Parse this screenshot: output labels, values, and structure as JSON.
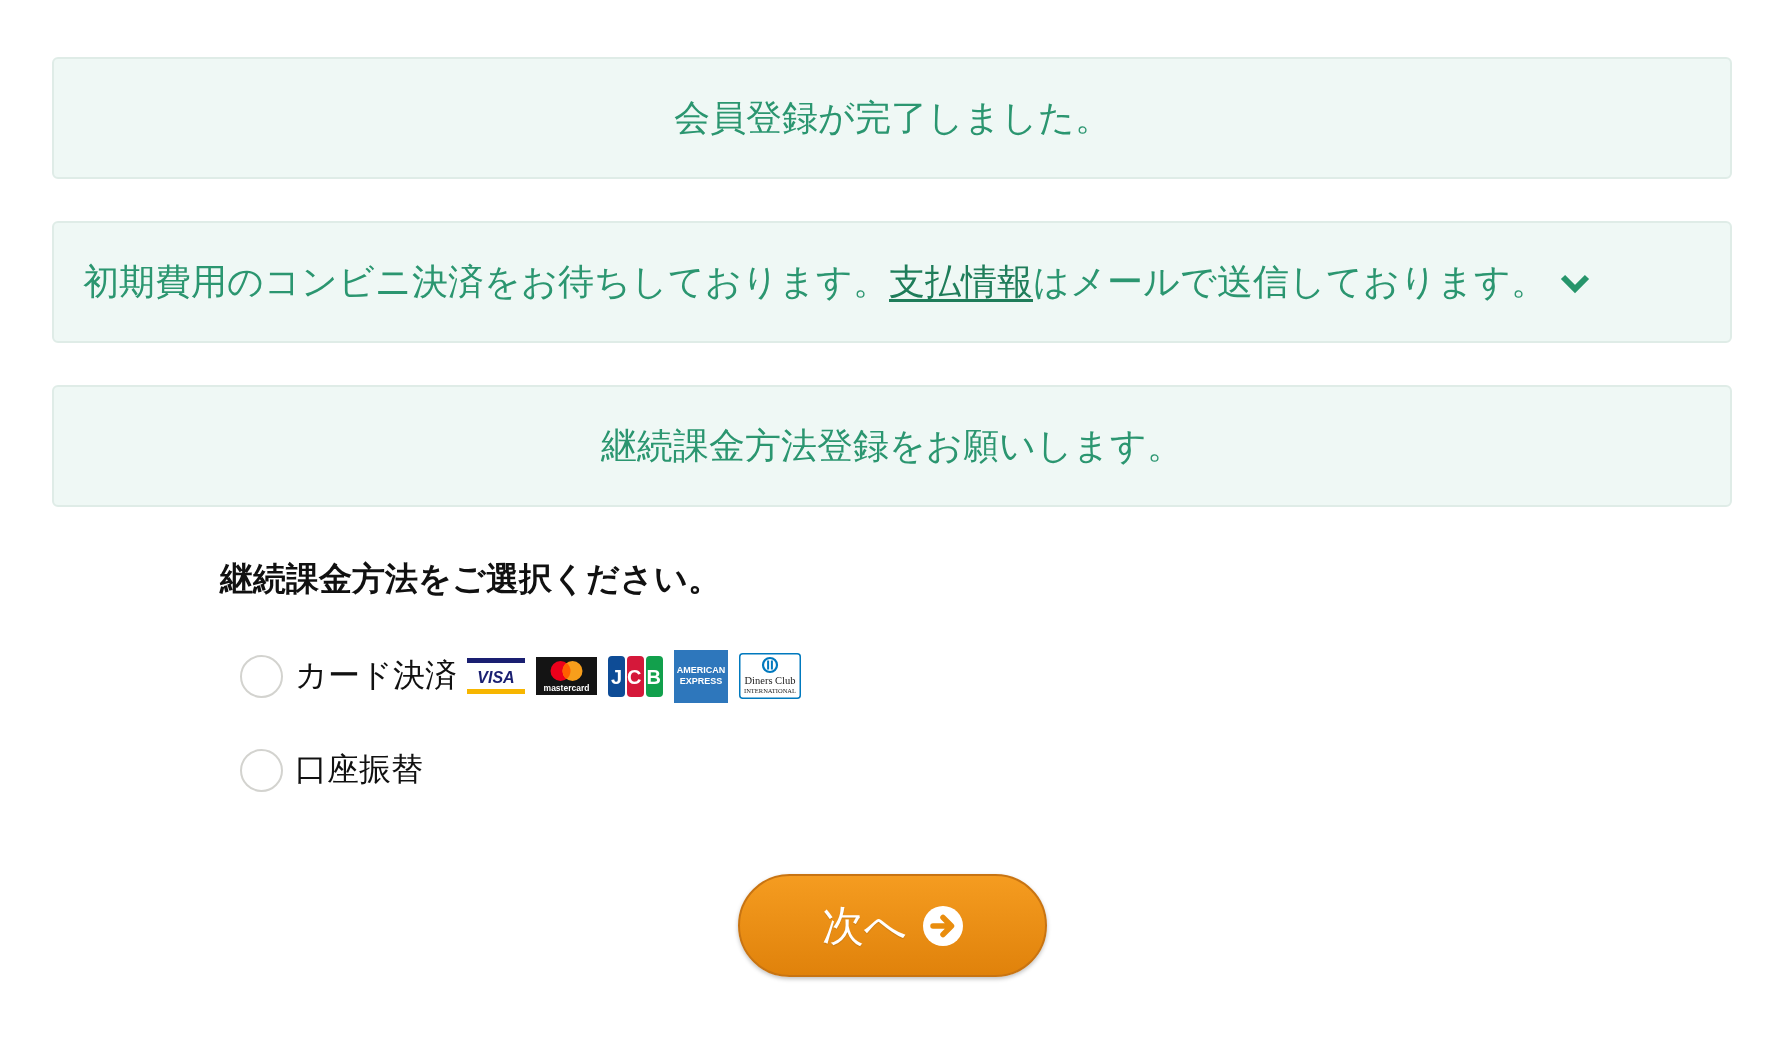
{
  "notices": [
    {
      "kind": "message",
      "text": "会員登録が完了しました。"
    },
    {
      "kind": "expandable",
      "text_before": "初期費用のコンビニ決済をお待ちしております。",
      "link": "支払情報",
      "text_after": "はメールで送信しております。",
      "expanded": false
    },
    {
      "kind": "message",
      "text": "継続課金方法登録をお願いします。"
    }
  ],
  "payment": {
    "heading": "継続課金方法をご選択ください。",
    "options": [
      {
        "label": "カード決済",
        "selected": false,
        "card_brands": [
          {
            "kind": "visa",
            "lines": [
              "VISA"
            ]
          },
          {
            "kind": "mastercard",
            "lines": [
              "mastercard"
            ]
          },
          {
            "kind": "jcb",
            "lines": [
              "JCB"
            ]
          },
          {
            "kind": "amex",
            "lines": [
              "AMERICAN",
              "EXPRESS"
            ]
          },
          {
            "kind": "diners",
            "lines": [
              "Diners Club",
              "INTERNATIONAL"
            ]
          }
        ]
      },
      {
        "label": "口座振替",
        "selected": false
      }
    ]
  },
  "next_button": {
    "label": "次へ"
  }
}
